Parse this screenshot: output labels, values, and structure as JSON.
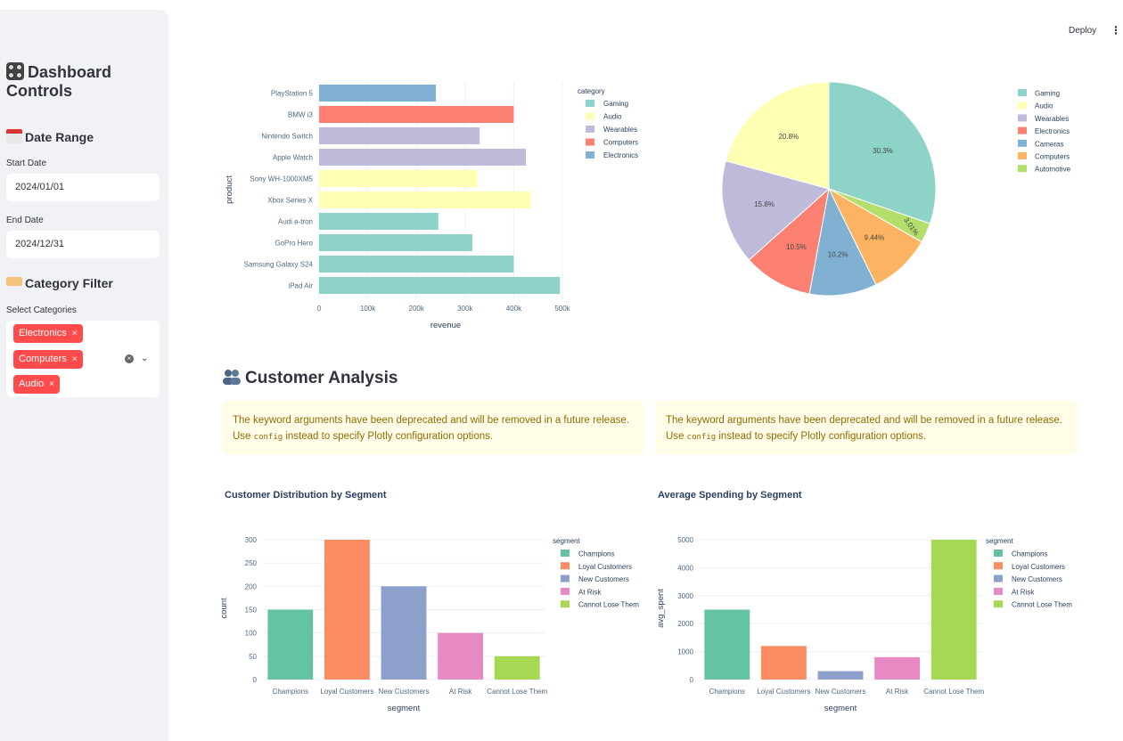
{
  "header": {
    "deploy_label": "Deploy",
    "menu_icon": "kebab-menu-icon"
  },
  "sidebar": {
    "title_line1": "Dashboard",
    "title_line2": "Controls",
    "date_section": "Date Range",
    "start_label": "Start Date",
    "start_value": "2024/01/01",
    "end_label": "End Date",
    "end_value": "2024/12/31",
    "category_section": "Category Filter",
    "select_label": "Select Categories",
    "chips": [
      "Electronics",
      "Computers",
      "Audio"
    ],
    "chip_remove": "×"
  },
  "customer_section_title": "Customer Analysis",
  "warning": {
    "line1": "The keyword arguments have been deprecated and will be removed in a future release.",
    "use": "Use",
    "code": "config",
    "line2_rest": "instead to specify Plotly configuration options."
  },
  "colors": {
    "Gaming": "#8dd3c7",
    "Audio": "#ffffb3",
    "Wearables": "#bebada",
    "Electronics": "#80b1d3",
    "Computers": "#fb8072",
    "Cameras": "#80b1d3",
    "Automotive": "#b3de69",
    "Champions": "#66c2a5",
    "Loyal Customers": "#fc8d62",
    "New Customers": "#8da0cb",
    "At Risk": "#e78ac3",
    "Cannot Lose Them": "#a6d854",
    "PieComputers": "#fdb462"
  },
  "chart_data": [
    {
      "type": "bar",
      "orientation": "horizontal",
      "categories": [
        "PlayStation 5",
        "BMW i3",
        "Nintendo Switch",
        "Apple Watch",
        "Sony WH-1000XM5",
        "Xbox Series X",
        "Audi e-tron",
        "GoPro Hero",
        "Samsung Galaxy S24",
        "iPad Air"
      ],
      "values": [
        240000,
        400000,
        330000,
        425000,
        325000,
        435000,
        245000,
        315000,
        400000,
        495000
      ],
      "bar_category": [
        "Electronics",
        "Computers",
        "Wearables",
        "Wearables",
        "Audio",
        "Audio",
        "Gaming",
        "Gaming",
        "Gaming",
        "Gaming"
      ],
      "xlabel": "revenue",
      "ylabel": "product",
      "xticks": [
        "0",
        "100k",
        "200k",
        "300k",
        "400k",
        "500k"
      ],
      "xlim": [
        0,
        500000
      ],
      "legend_title": "category",
      "legend": [
        "Gaming",
        "Audio",
        "Wearables",
        "Computers",
        "Electronics"
      ]
    },
    {
      "type": "pie",
      "labels": [
        "Gaming",
        "Automotive",
        "Computers",
        "Cameras",
        "Electronics",
        "Wearables",
        "Audio"
      ],
      "values": [
        30.3,
        3.01,
        9.44,
        10.2,
        10.5,
        15.8,
        20.8
      ],
      "text": [
        "30.3%",
        "3.01%",
        "9.44%",
        "10.2%",
        "10.5%",
        "15.8%",
        "20.8%"
      ],
      "slice_colors": [
        "#8dd3c7",
        "#b3de69",
        "#fdb462",
        "#80b1d3",
        "#fb8072",
        "#bebada",
        "#ffffb3"
      ],
      "legend": [
        "Gaming",
        "Audio",
        "Wearables",
        "Electronics",
        "Cameras",
        "Computers",
        "Automotive"
      ],
      "legend_colors": [
        "#8dd3c7",
        "#ffffb3",
        "#bebada",
        "#fb8072",
        "#80b1d3",
        "#fdb462",
        "#b3de69"
      ]
    },
    {
      "type": "bar",
      "title": "Customer Distribution by Segment",
      "categories": [
        "Champions",
        "Loyal Customers",
        "New Customers",
        "At Risk",
        "Cannot Lose Them"
      ],
      "values": [
        150,
        300,
        200,
        100,
        50
      ],
      "xlabel": "segment",
      "ylabel": "count",
      "yticks": [
        "0",
        "50",
        "100",
        "150",
        "200",
        "250",
        "300"
      ],
      "ylim": [
        0,
        300
      ],
      "legend_title": "segment",
      "legend": [
        "Champions",
        "Loyal Customers",
        "New Customers",
        "At Risk",
        "Cannot Lose Them"
      ]
    },
    {
      "type": "bar",
      "title": "Average Spending by Segment",
      "categories": [
        "Champions",
        "Loyal Customers",
        "New Customers",
        "At Risk",
        "Cannot Lose Them"
      ],
      "values": [
        2500,
        1200,
        300,
        800,
        5000
      ],
      "xlabel": "segment",
      "ylabel": "avg_spent",
      "yticks": [
        "0",
        "1000",
        "2000",
        "3000",
        "4000",
        "5000"
      ],
      "ylim": [
        0,
        5000
      ],
      "legend_title": "segment",
      "legend": [
        "Champions",
        "Loyal Customers",
        "New Customers",
        "At Risk",
        "Cannot Lose Them"
      ]
    }
  ]
}
